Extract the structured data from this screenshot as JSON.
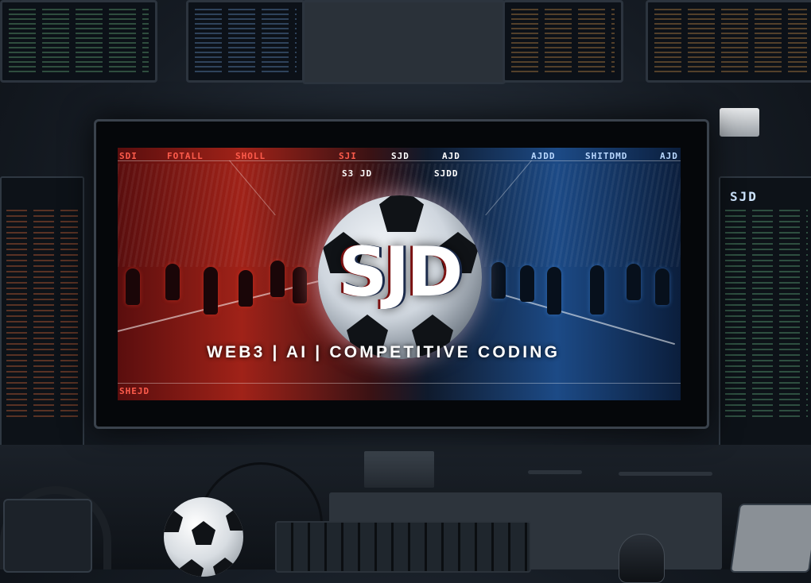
{
  "screen": {
    "hud_top": [
      "SDI",
      "FOTALL",
      "SHOLL",
      "SJI",
      "SJD",
      "AJD",
      "AJDD",
      "SHITDMD",
      "AJD"
    ],
    "hud_scores": [
      "S3 JD",
      "SJDD"
    ],
    "hud_bottom": "SHEJD"
  },
  "logo": "SJD",
  "tagline": "WEB3 | AI | COMPETITIVE CODING",
  "side_right": {
    "title": "SJD"
  },
  "colors": {
    "accent_red": "#d2281c",
    "accent_blue": "#2a6fd1"
  }
}
